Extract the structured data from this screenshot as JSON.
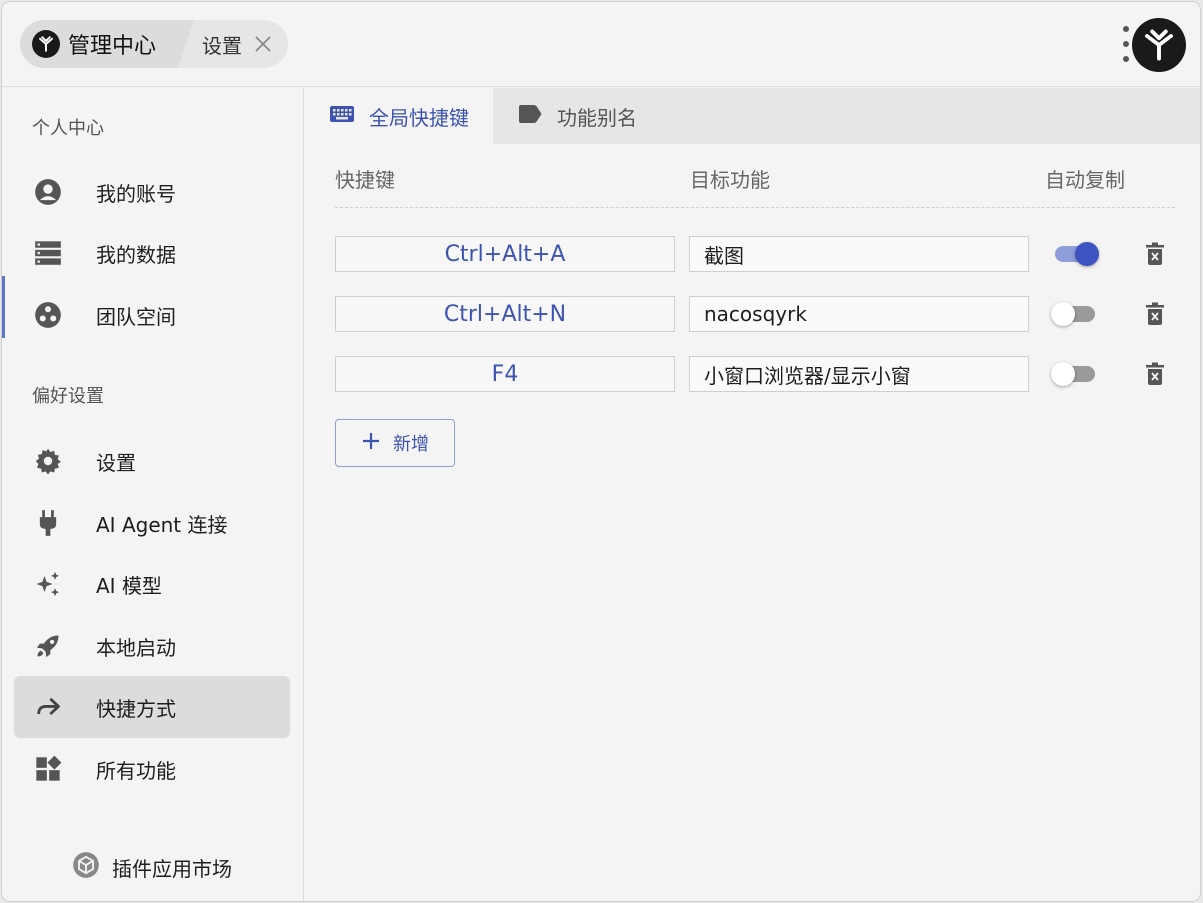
{
  "header": {
    "app_tab_label": "管理中心",
    "sub_tab_label": "设置"
  },
  "sidebar": {
    "section_personal": "个人中心",
    "section_preferences": "偏好设置",
    "items": [
      {
        "label": "我的账号",
        "icon": "account-circle-icon"
      },
      {
        "label": "我的数据",
        "icon": "database-icon"
      },
      {
        "label": "团队空间",
        "icon": "team-icon"
      },
      {
        "label": "设置",
        "icon": "gear-icon"
      },
      {
        "label": "AI Agent 连接",
        "icon": "plug-icon"
      },
      {
        "label": "AI 模型",
        "icon": "sparkle-icon"
      },
      {
        "label": "本地启动",
        "icon": "rocket-icon"
      },
      {
        "label": "快捷方式",
        "icon": "share-arrow-icon"
      },
      {
        "label": "所有功能",
        "icon": "widgets-icon"
      }
    ],
    "active_item": "快捷方式",
    "plugin_market_label": "插件应用市场"
  },
  "main": {
    "tabs": [
      {
        "label": "全局快捷键",
        "icon": "keyboard-icon",
        "active": true
      },
      {
        "label": "功能别名",
        "icon": "label-tag-icon",
        "active": false
      }
    ],
    "columns": {
      "shortcut": "快捷键",
      "target": "目标功能",
      "auto_copy": "自动复制"
    },
    "rows": [
      {
        "shortcut": "Ctrl+Alt+A",
        "target": "截图",
        "auto_copy": true
      },
      {
        "shortcut": "Ctrl+Alt+N",
        "target": "nacosqyrk",
        "auto_copy": false
      },
      {
        "shortcut": "F4",
        "target": "小窗口浏览器/显示小窗",
        "auto_copy": false
      }
    ],
    "add_button_label": "新增"
  },
  "colors": {
    "accent": "#3d53b0",
    "toggle_on": "#3d53c0",
    "active_bg": "#dcdcdc",
    "window_bg": "#f4f4f4"
  }
}
